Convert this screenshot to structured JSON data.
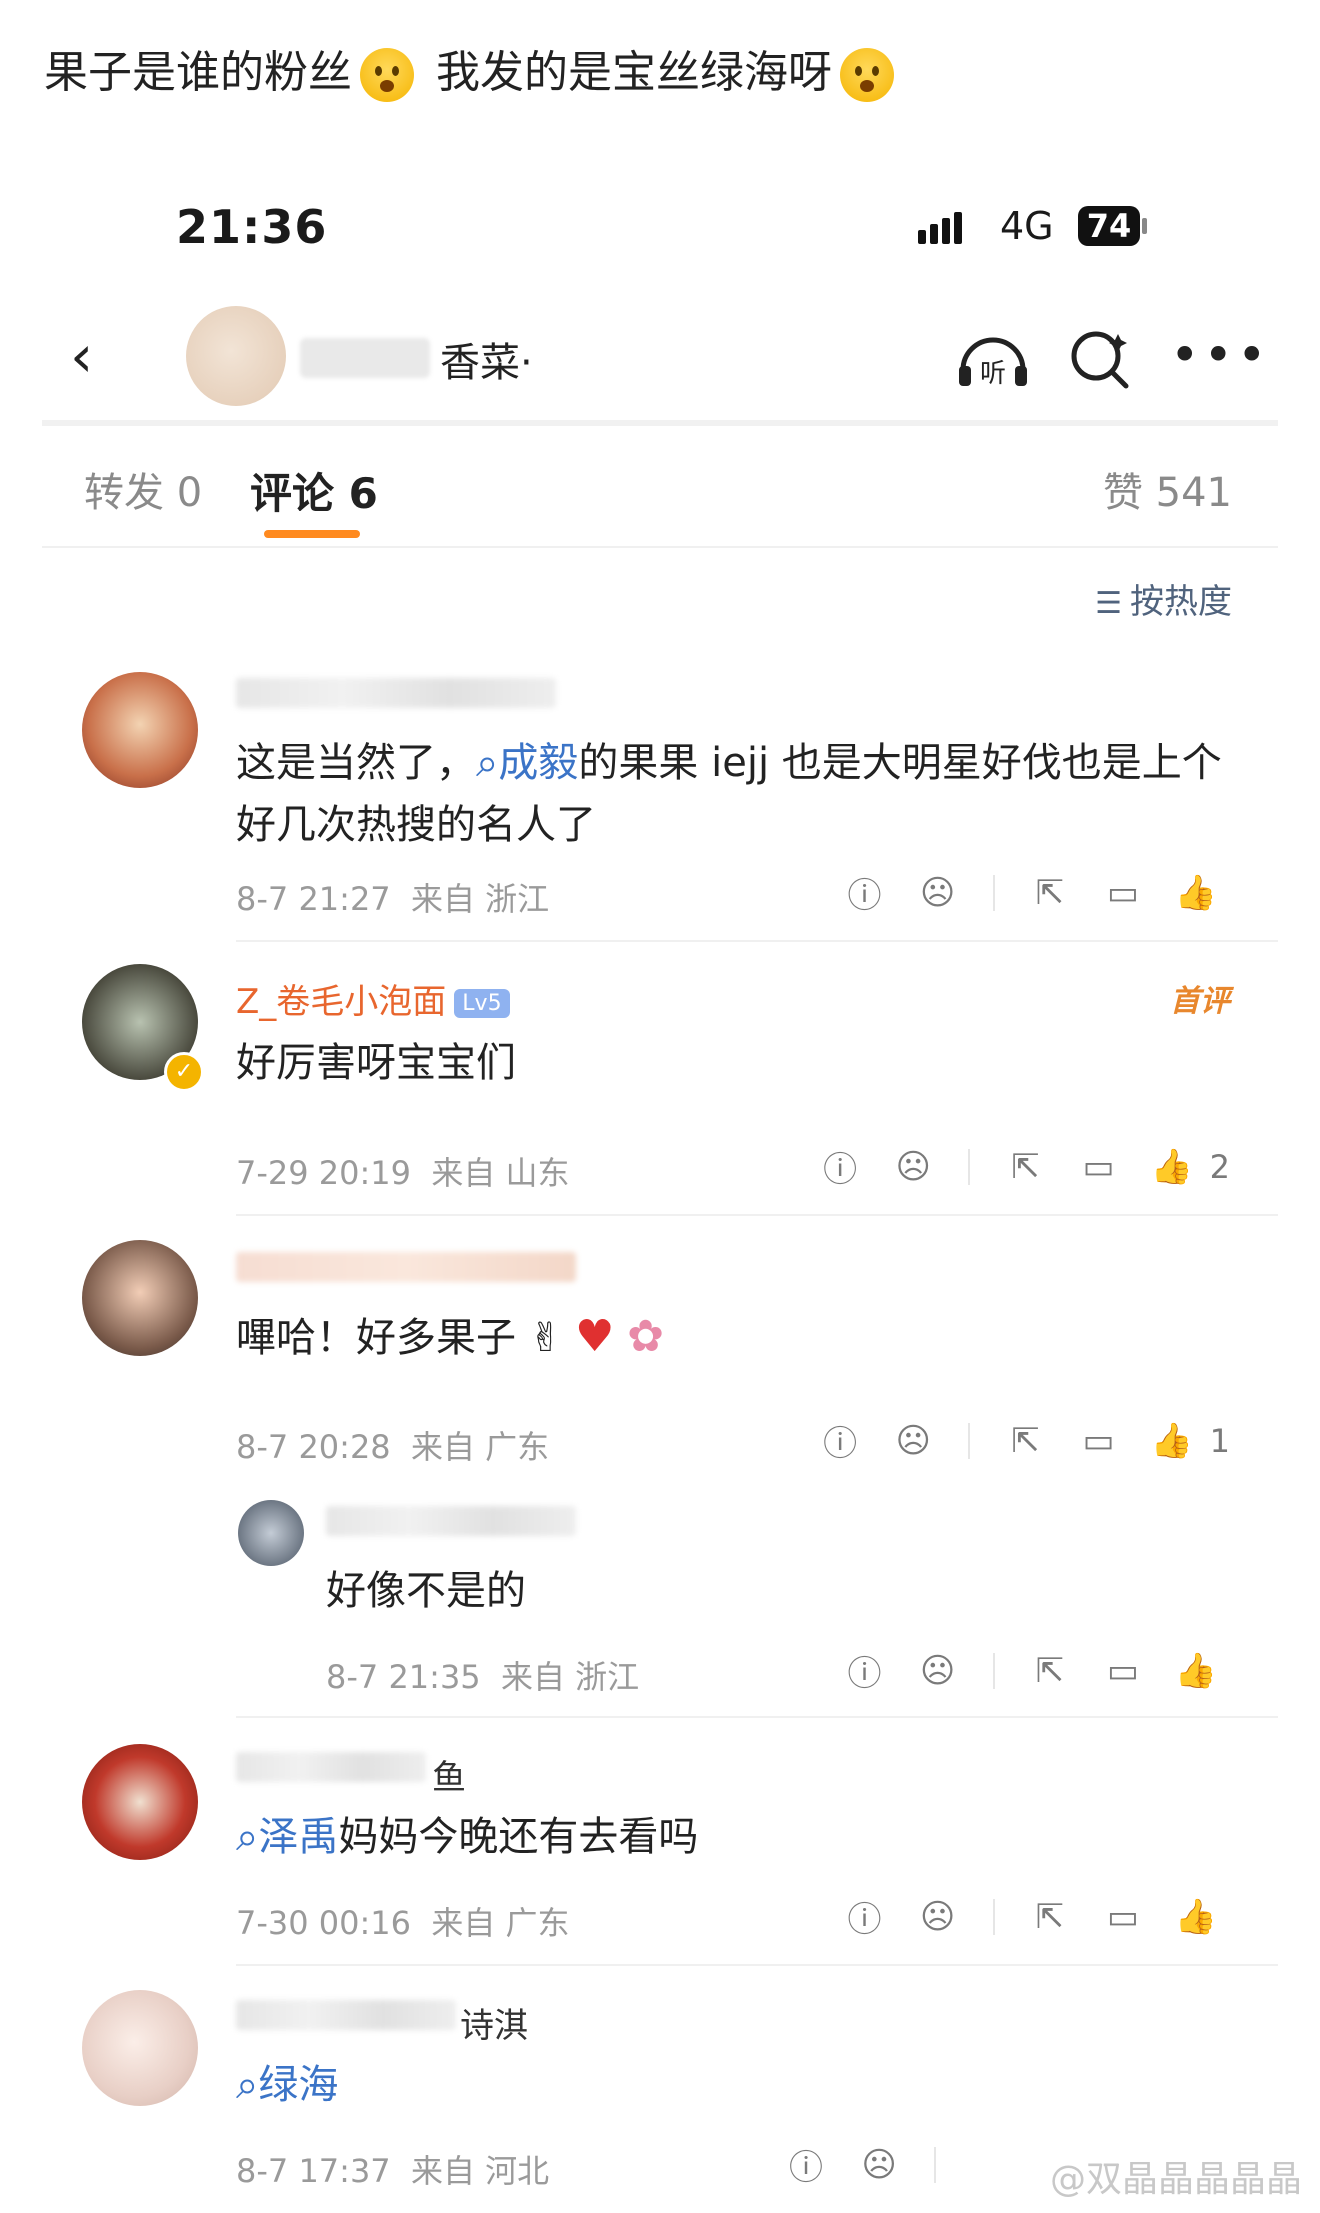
{
  "caption": {
    "part1": "果子是谁的粉丝",
    "part2": "我发的是宝丝绿海呀"
  },
  "status_bar": {
    "time": "21:36",
    "network": "4G",
    "battery": "74"
  },
  "nav": {
    "back_icon": "chevron-left-icon",
    "title_visible": "香菜·",
    "listen_icon": "headphones-listen-icon",
    "search_icon": "search-icon",
    "more_icon": "more-dots-icon",
    "listen_label": "听"
  },
  "tabs": {
    "repost": "转发 0",
    "comments": "评论 6",
    "likes": "赞 541"
  },
  "sort": {
    "label": "按热度",
    "icon": "sort-icon"
  },
  "comments": [
    {
      "username_visible": "",
      "text_before": "这是当然了，",
      "topic": "成毅",
      "text_after": "的果果 iejj 也是大明星好伐也是上个好几次热搜的名人了",
      "time": "8-7 21:27",
      "from": "来自 浙江",
      "likes": ""
    },
    {
      "username_visible": "Z_卷毛小泡面",
      "badge": "首评",
      "text": "好厉害呀宝宝们",
      "time": "7-29 20:19",
      "from": "来自 山东",
      "likes": "2"
    },
    {
      "username_visible": "",
      "text": "嗶哈！好多果子",
      "time": "8-7 20:28",
      "from": "来自 广东",
      "likes": "1"
    },
    {
      "username_visible": "",
      "text": "好像不是的",
      "time": "8-7 21:35",
      "from": "来自 浙江",
      "likes": "",
      "is_reply": true
    },
    {
      "username_visible": "鱼",
      "topic": "泽禹",
      "text_after": "妈妈今晚还有去看吗",
      "time": "7-30 00:16",
      "from": "来自 广东",
      "likes": ""
    },
    {
      "username_visible": "诗淇",
      "topic": "绿海",
      "time": "8-7 17:37",
      "from": "来自 河北",
      "likes": ""
    }
  ],
  "watermark": "@双晶晶晶晶晶",
  "colors": {
    "accent_orange": "#ff8a1f",
    "topic_blue": "#3b74c7",
    "username_orange": "#e8662e"
  }
}
